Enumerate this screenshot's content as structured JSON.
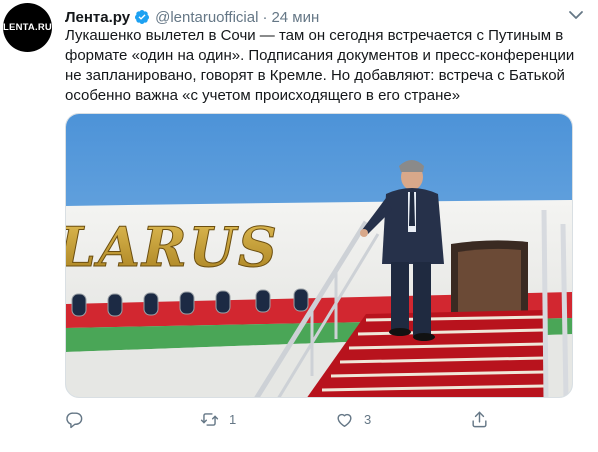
{
  "tweet": {
    "avatar_text": "LENTA.RU",
    "author_name": "Лента.ру",
    "handle": "@lentaruofficial",
    "separator": "·",
    "time": "24 мин",
    "text": "Лукашенко вылетел в Сочи — там он сегодня встречается с Путиным в формате «один на один». Подписания документов и пресс-конференции не запланировано, говорят в Кремле. Но добавляют: встреча с Батькой особенно важна «с учетом происходящего в его стране»",
    "photo_text": "LARUS"
  },
  "actions": {
    "reply_count": "",
    "retweet_count": "1",
    "like_count": "3"
  },
  "colors": {
    "text": "#14171a",
    "secondary": "#657786",
    "verified": "#1da1f2",
    "belarus_red": "#d22730",
    "belarus_green": "#4aa657",
    "gold": "#c9a227"
  }
}
